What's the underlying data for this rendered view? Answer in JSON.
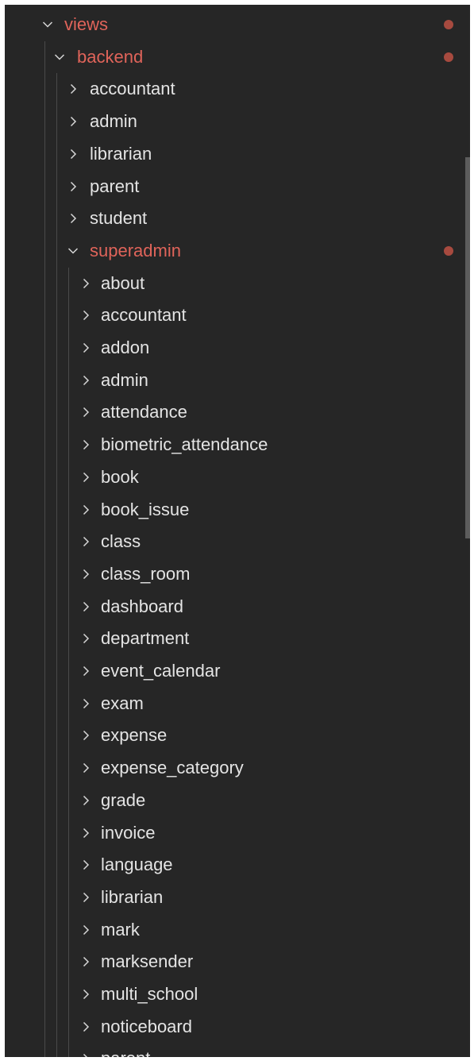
{
  "explorer": {
    "items": [
      {
        "label": "views",
        "depth": 0,
        "expanded": true,
        "modified": true
      },
      {
        "label": "backend",
        "depth": 1,
        "expanded": true,
        "modified": true
      },
      {
        "label": "accountant",
        "depth": 2,
        "expanded": false,
        "modified": false
      },
      {
        "label": "admin",
        "depth": 2,
        "expanded": false,
        "modified": false
      },
      {
        "label": "librarian",
        "depth": 2,
        "expanded": false,
        "modified": false
      },
      {
        "label": "parent",
        "depth": 2,
        "expanded": false,
        "modified": false
      },
      {
        "label": "student",
        "depth": 2,
        "expanded": false,
        "modified": false
      },
      {
        "label": "superadmin",
        "depth": 2,
        "expanded": true,
        "modified": true
      },
      {
        "label": "about",
        "depth": 3,
        "expanded": false,
        "modified": false
      },
      {
        "label": "accountant",
        "depth": 3,
        "expanded": false,
        "modified": false
      },
      {
        "label": "addon",
        "depth": 3,
        "expanded": false,
        "modified": false
      },
      {
        "label": "admin",
        "depth": 3,
        "expanded": false,
        "modified": false
      },
      {
        "label": "attendance",
        "depth": 3,
        "expanded": false,
        "modified": false
      },
      {
        "label": "biometric_attendance",
        "depth": 3,
        "expanded": false,
        "modified": false
      },
      {
        "label": "book",
        "depth": 3,
        "expanded": false,
        "modified": false
      },
      {
        "label": "book_issue",
        "depth": 3,
        "expanded": false,
        "modified": false
      },
      {
        "label": "class",
        "depth": 3,
        "expanded": false,
        "modified": false
      },
      {
        "label": "class_room",
        "depth": 3,
        "expanded": false,
        "modified": false
      },
      {
        "label": "dashboard",
        "depth": 3,
        "expanded": false,
        "modified": false
      },
      {
        "label": "department",
        "depth": 3,
        "expanded": false,
        "modified": false
      },
      {
        "label": "event_calendar",
        "depth": 3,
        "expanded": false,
        "modified": false
      },
      {
        "label": "exam",
        "depth": 3,
        "expanded": false,
        "modified": false
      },
      {
        "label": "expense",
        "depth": 3,
        "expanded": false,
        "modified": false
      },
      {
        "label": "expense_category",
        "depth": 3,
        "expanded": false,
        "modified": false
      },
      {
        "label": "grade",
        "depth": 3,
        "expanded": false,
        "modified": false
      },
      {
        "label": "invoice",
        "depth": 3,
        "expanded": false,
        "modified": false
      },
      {
        "label": "language",
        "depth": 3,
        "expanded": false,
        "modified": false
      },
      {
        "label": "librarian",
        "depth": 3,
        "expanded": false,
        "modified": false
      },
      {
        "label": "mark",
        "depth": 3,
        "expanded": false,
        "modified": false
      },
      {
        "label": "marksender",
        "depth": 3,
        "expanded": false,
        "modified": false
      },
      {
        "label": "multi_school",
        "depth": 3,
        "expanded": false,
        "modified": false
      },
      {
        "label": "noticeboard",
        "depth": 3,
        "expanded": false,
        "modified": false
      },
      {
        "label": "parent",
        "depth": 3,
        "expanded": false,
        "modified": false
      }
    ]
  },
  "colors": {
    "background": "#262626",
    "text": "#e4e4e4",
    "modified_text": "#e0645a",
    "modified_dot": "#a74a3f",
    "chevron": "#d6d6d6",
    "indent_guide": "#4a4a4a",
    "scrollbar_thumb": "#5c5c5c"
  },
  "icons": {
    "expanded": "chevron-down-icon",
    "collapsed": "chevron-right-icon",
    "modified": "modified-dot-icon"
  }
}
